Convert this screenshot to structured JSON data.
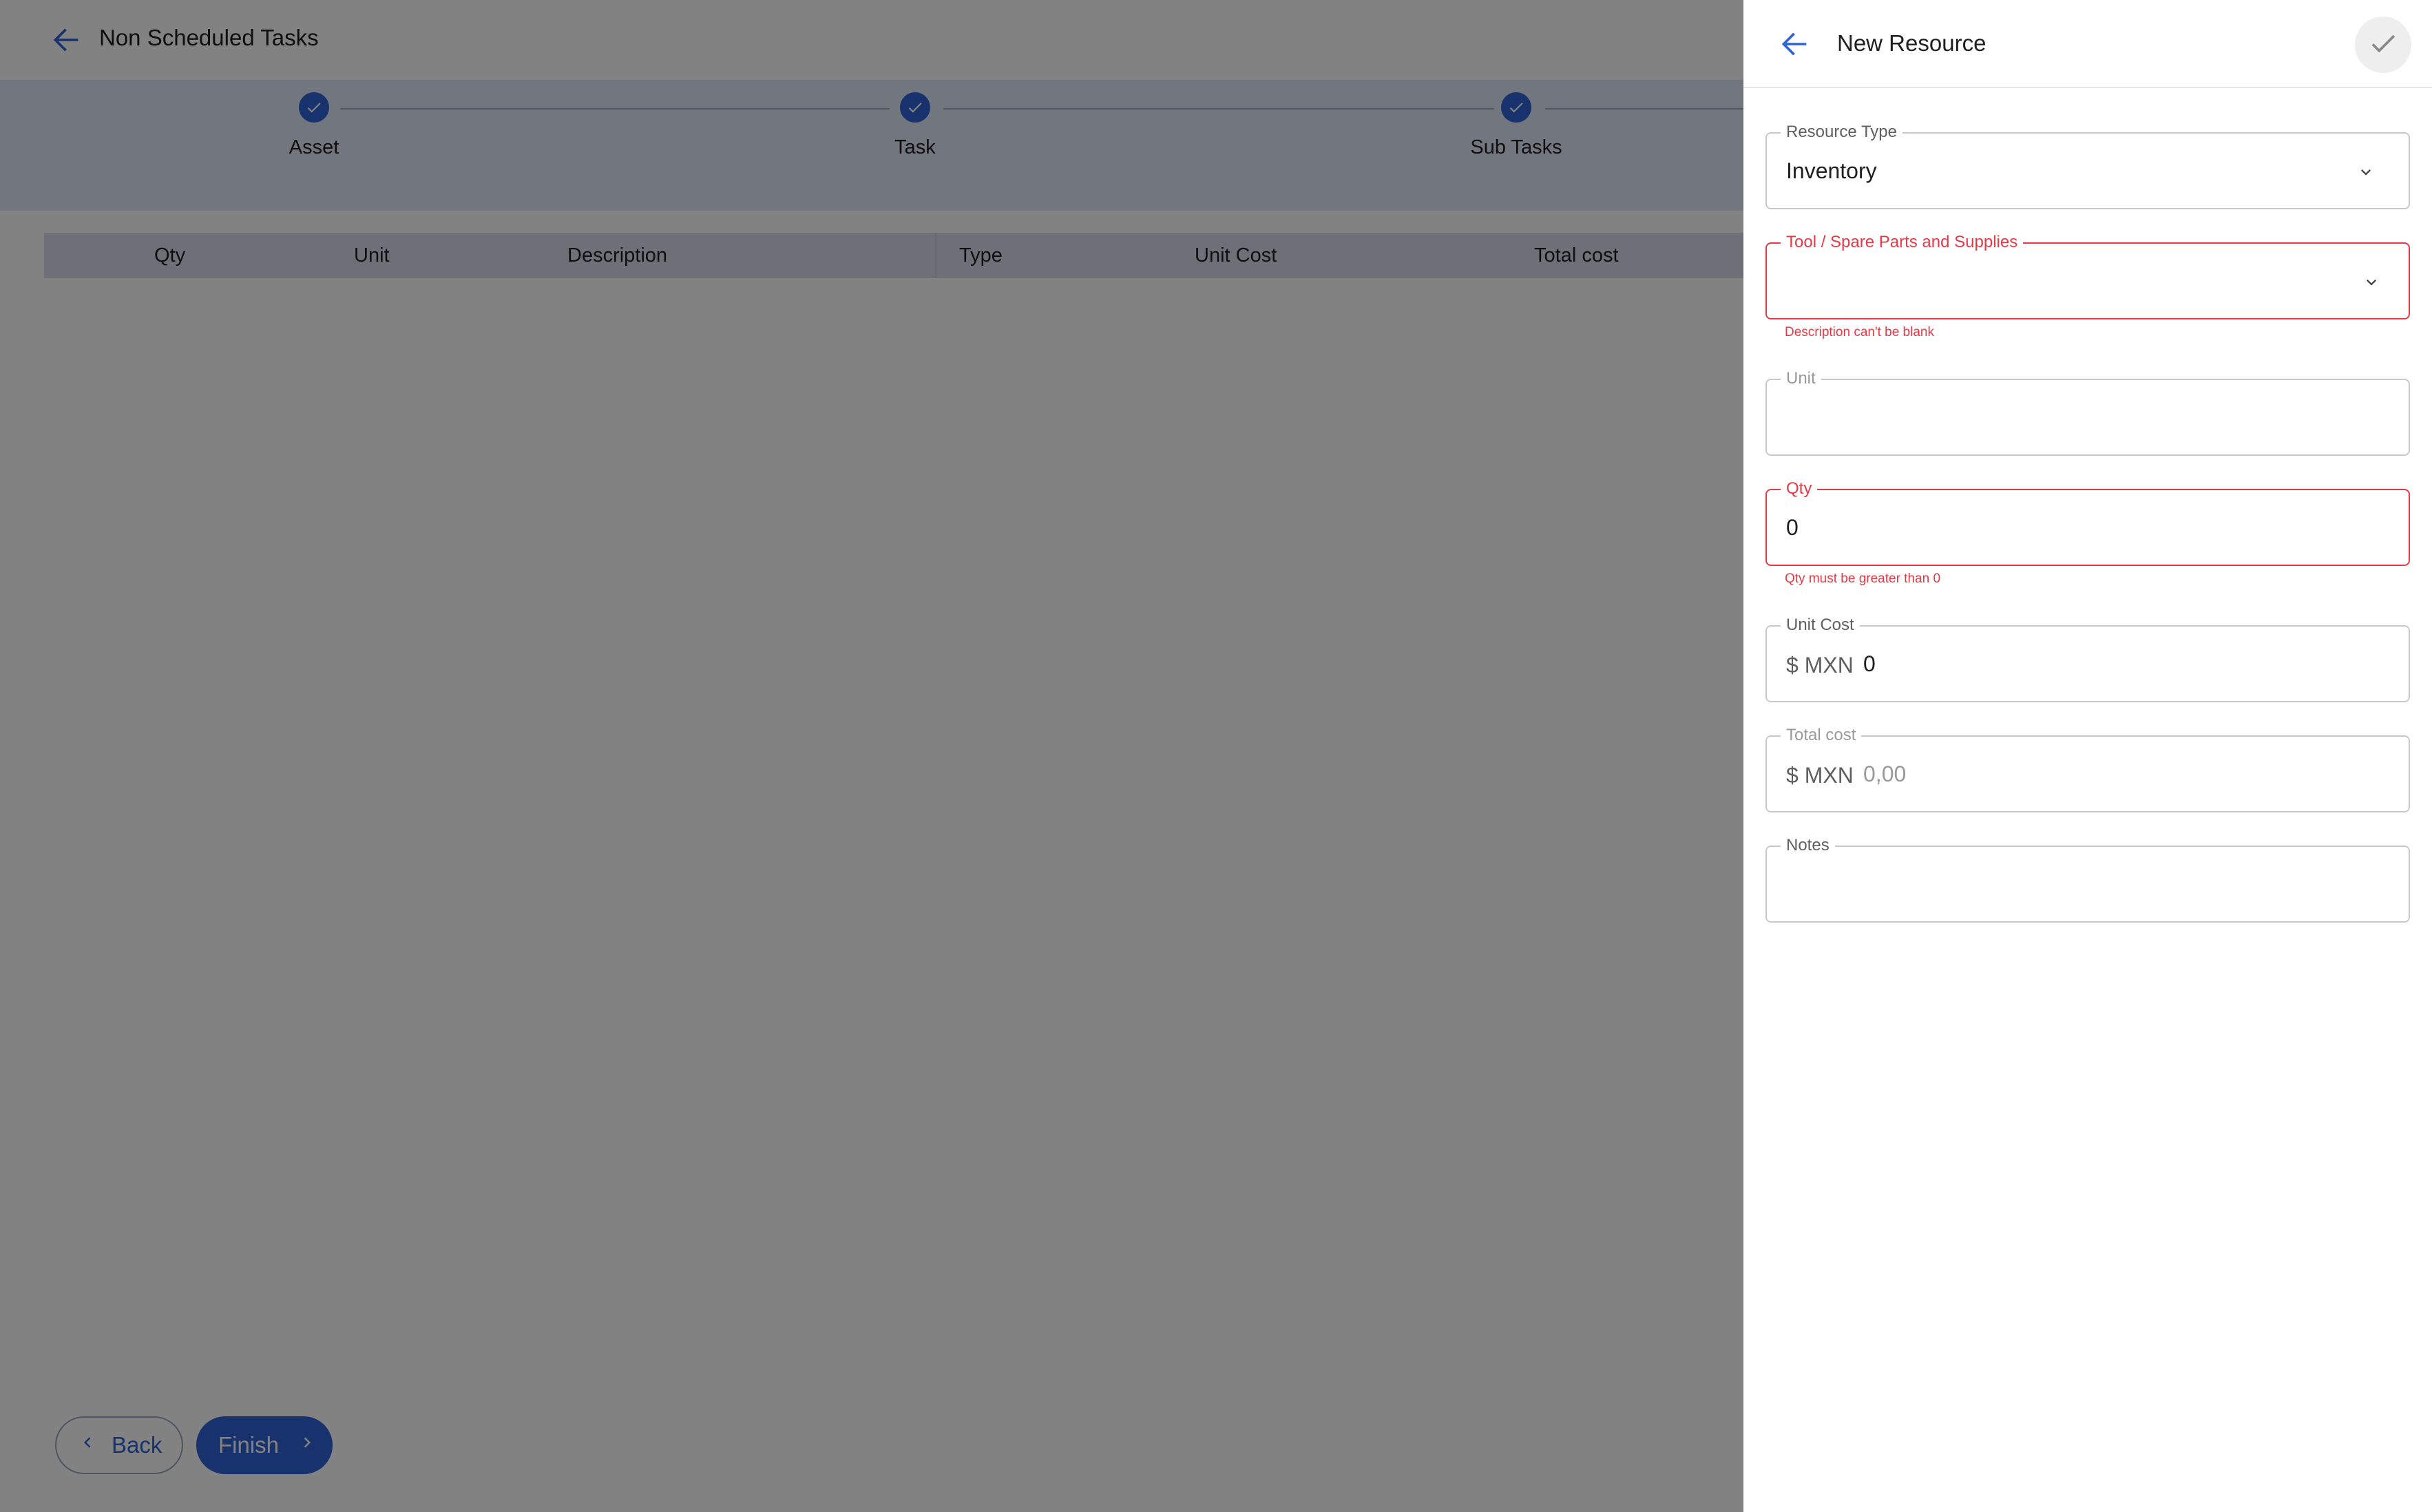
{
  "page": {
    "title": "Non Scheduled Tasks",
    "back_icon": "arrow-left-icon"
  },
  "stepper": {
    "steps": [
      {
        "label": "Asset",
        "done": true
      },
      {
        "label": "Task",
        "done": true
      },
      {
        "label": "Sub Tasks",
        "done": true
      }
    ]
  },
  "table": {
    "headers": [
      "Qty",
      "Unit",
      "Description",
      "Type",
      "Unit Cost",
      "Total cost"
    ],
    "rows": []
  },
  "footer": {
    "back_label": "Back",
    "finish_label": "Finish"
  },
  "panel": {
    "title": "New Resource",
    "confirm_icon": "check-icon",
    "fields": {
      "resource_type": {
        "label": "Resource Type",
        "value": "Inventory"
      },
      "tool": {
        "label": "Tool / Spare Parts and Supplies",
        "value": "",
        "error": "Description can't be blank"
      },
      "unit": {
        "label": "Unit",
        "value": ""
      },
      "qty": {
        "label": "Qty",
        "value": "0",
        "error": "Qty must be greater than 0"
      },
      "unit_cost": {
        "label": "Unit Cost",
        "prefix": "$ MXN",
        "value": "0"
      },
      "total_cost": {
        "label": "Total cost",
        "prefix": "$ MXN",
        "value": "0,00"
      },
      "notes": {
        "label": "Notes",
        "value": ""
      }
    }
  },
  "colors": {
    "accent": "#2f63d6",
    "error": "#e53945",
    "stepper_bg": "#dfe7f7",
    "table_header_bg": "#d6ddea"
  }
}
